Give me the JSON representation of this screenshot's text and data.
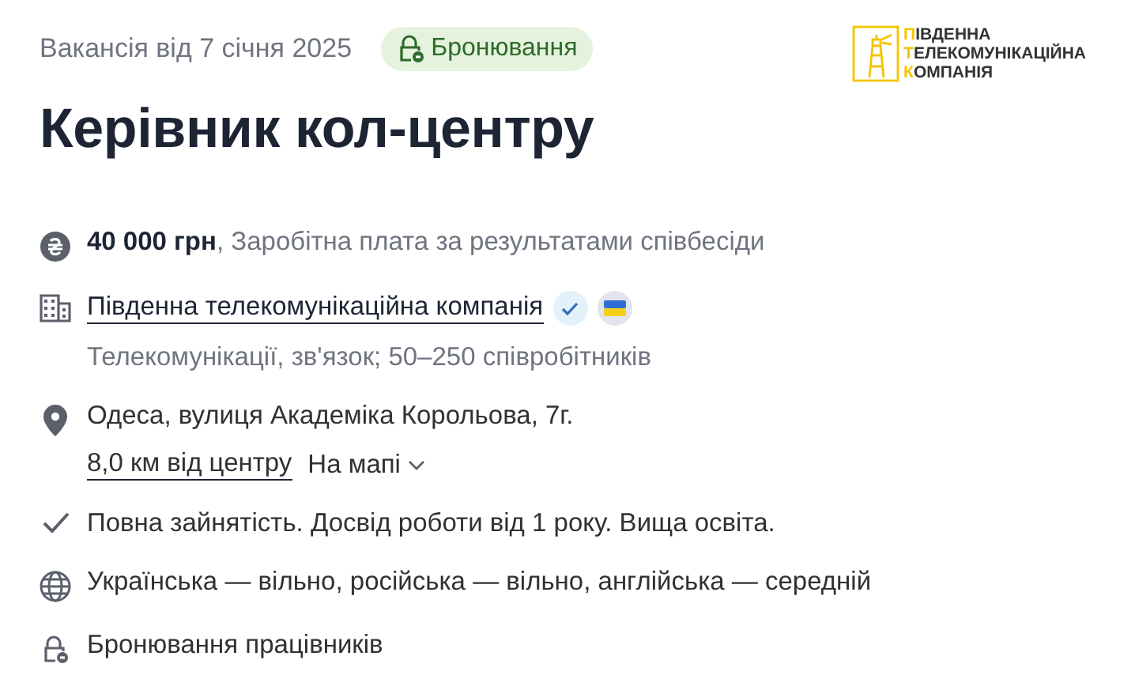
{
  "header": {
    "date": "Вакансія від 7 січня 2025",
    "badge": "Бронювання"
  },
  "logo": {
    "lines": [
      {
        "initial": "П",
        "rest": "ІВДЕННА"
      },
      {
        "initial": "Т",
        "rest": "ЕЛЕКОМУНІКАЦІЙНА"
      },
      {
        "initial": "К",
        "rest": "ОМПАНІЯ"
      }
    ]
  },
  "title": "Керівник кол-центру",
  "details": [
    {
      "kind": "salary",
      "amount": "40 000 грн",
      "text": ", Заробітна плата за результатами співбесіди"
    },
    {
      "kind": "company",
      "name": "Південна телекомунікаційна компанія",
      "verified": true,
      "ukraine_flag": true,
      "subtext": "Телекомунікації, зв'язок; 50–250 співробітників"
    },
    {
      "kind": "location",
      "address": "Одеса, вулиця Академіка Корольова, 7г.",
      "distance": "8,0 км від центру",
      "map_link": "На мапі",
      "map_expanded": false
    },
    {
      "kind": "check",
      "text": "Повна зайнятість. Досвід роботи від 1 року. Вища освіта."
    },
    {
      "kind": "languages",
      "text": "Українська — вільно, російська — вільно, англійська — середній"
    },
    {
      "kind": "reservation",
      "text": "Бронювання працівників"
    }
  ]
}
